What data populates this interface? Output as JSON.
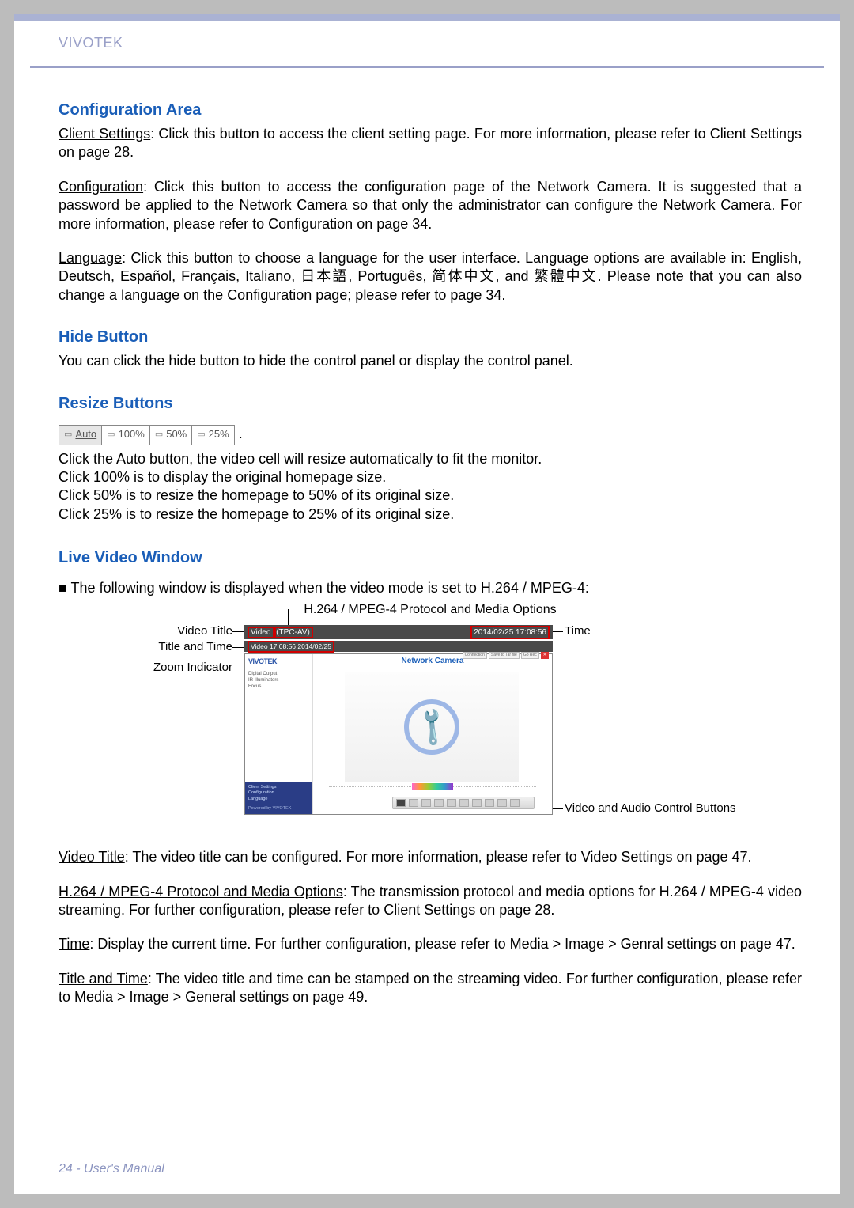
{
  "header": {
    "brand": "VIVOTEK"
  },
  "sections": {
    "config_area_title": "Configuration Area",
    "client_settings_label": "Client Settings",
    "client_settings_text": ": Click this button to access the client setting page. For more information, please refer to Client Settings on page 28.",
    "configuration_label": "Configuration",
    "configuration_text": ": Click this button to access the configuration page of the Network Camera. It is suggested that a password be applied to the Network Camera so that only the administrator can configure the Network Camera. For more information, please refer to Configuration on page 34.",
    "language_label": "Language",
    "language_text": ": Click this button to choose a language for the user interface. Language options are available in: English, Deutsch, Español, Français, Italiano, 日本語, Português, 简体中文, and 繁體中文.  Please note that you can also change a language on the Configuration page; please refer to page 34.",
    "hide_title": "Hide Button",
    "hide_text": "You can click the hide button to hide the control panel or display the control panel.",
    "resize_title": "Resize Buttons",
    "resize_buttons": [
      "Auto",
      "100%",
      "50%",
      "25%"
    ],
    "resize_lines": [
      "Click the Auto button, the video cell will resize automatically to fit the monitor.",
      "Click 100% is to display the original homepage size.",
      "Click 50% is to resize the homepage to 50% of its original size.",
      "Click 25% is to resize the homepage to 25% of its original size."
    ],
    "lvw_title": "Live Video Window",
    "lvw_intro": "■ The following window is displayed when the video mode is set to H.264 / MPEG-4:",
    "lvw_caption": "H.264 / MPEG-4 Protocol and Media Options",
    "callouts": {
      "video_title": "Video Title",
      "title_and_time": "Title and Time",
      "zoom_indicator": "Zoom Indicator",
      "time": "Time",
      "vac": "Video and Audio Control Buttons"
    },
    "lvw_bar": {
      "left": "Video",
      "mid": "(TPC-AV)",
      "right": "2014/02/25  17:08:56"
    },
    "lvw_stamp": "Video 17:08:56  2014/02/25",
    "lvw_side_logo": "VIVOTEK",
    "lvw_side_items": [
      "Digital Output",
      "IR Illuminators",
      "Focus"
    ],
    "lvw_side_links": [
      "Client Settings",
      "Configuration",
      "Language"
    ],
    "lvw_side_footer": "Powered by VIVOTEK",
    "nc_title": "Network Camera",
    "nc_tabs": [
      "Connection",
      "Save to Tar file",
      "Go Rec"
    ],
    "video_title_label": "Video Title",
    "video_title_text": ": The video title can be configured. For more information, please refer to Video Settings on page 47.",
    "proto_label": "H.264 / MPEG-4 Protocol and Media Options",
    "proto_text": ": The transmission protocol and media options for H.264 / MPEG-4 video streaming. For further configuration, please refer to Client Settings on page 28.",
    "time_label": "Time",
    "time_text": ": Display the current time. For further configuration, please refer to Media > Image > Genral settings on page 47.",
    "tt_label": "Title and Time",
    "tt_text": ": The video title and time can be stamped on the streaming video. For further configuration, please refer to Media > Image > General settings on page 49."
  },
  "footer": {
    "page": "24 - User's Manual"
  }
}
